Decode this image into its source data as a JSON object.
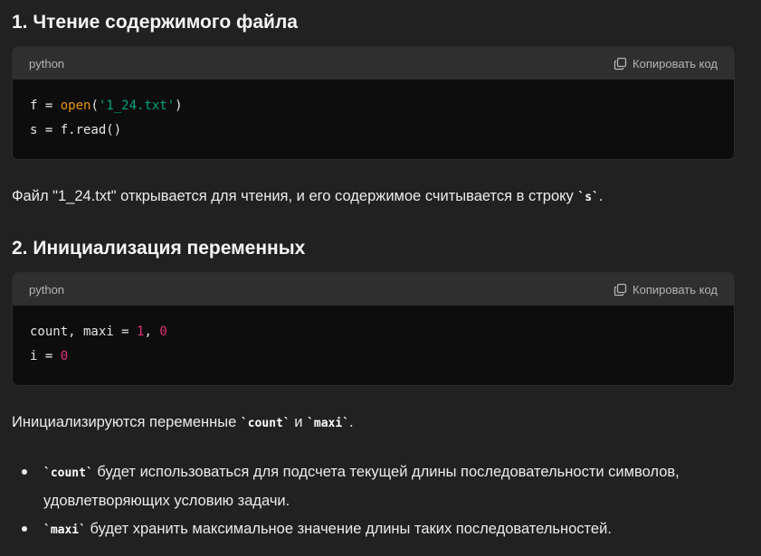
{
  "section1": {
    "heading": "1. Чтение содержимого файла",
    "code": {
      "language": "python",
      "copy_label": "Копировать код",
      "lines": [
        [
          {
            "t": "f = ",
            "c": "plain"
          },
          {
            "t": "open",
            "c": "fn"
          },
          {
            "t": "(",
            "c": "plain"
          },
          {
            "t": "'1_24.txt'",
            "c": "str"
          },
          {
            "t": ")",
            "c": "plain"
          }
        ],
        [
          {
            "t": "s = f.read()",
            "c": "plain"
          }
        ]
      ]
    },
    "paragraph": [
      {
        "t": "Файл \"1_24.txt\" открывается для чтения, и его содержимое считывается в строку ",
        "c": "text"
      },
      {
        "t": "`s`",
        "c": "code"
      },
      {
        "t": ".",
        "c": "text"
      }
    ]
  },
  "section2": {
    "heading": "2. Инициализация переменных",
    "code": {
      "language": "python",
      "copy_label": "Копировать код",
      "lines": [
        [
          {
            "t": "count, maxi = ",
            "c": "plain"
          },
          {
            "t": "1",
            "c": "num"
          },
          {
            "t": ", ",
            "c": "plain"
          },
          {
            "t": "0",
            "c": "num"
          }
        ],
        [
          {
            "t": "i = ",
            "c": "plain"
          },
          {
            "t": "0",
            "c": "num"
          }
        ]
      ]
    },
    "paragraph": [
      {
        "t": "Инициализируются переменные ",
        "c": "text"
      },
      {
        "t": "`count`",
        "c": "code"
      },
      {
        "t": " и ",
        "c": "text"
      },
      {
        "t": "`maxi`",
        "c": "code"
      },
      {
        "t": ".",
        "c": "text"
      }
    ],
    "bullets": [
      [
        {
          "t": "`count`",
          "c": "code"
        },
        {
          "t": " будет использоваться для подсчета текущей длины последовательности символов, удовлетворяющих условию задачи.",
          "c": "text"
        }
      ],
      [
        {
          "t": "`maxi`",
          "c": "code"
        },
        {
          "t": " будет хранить максимальное значение длины таких последовательностей.",
          "c": "text"
        }
      ]
    ]
  },
  "colors": {
    "background": "#212121",
    "code_header": "#2f2f2f",
    "code_body": "#0d0d0d",
    "function": "#e9950c",
    "string": "#00a67d",
    "number": "#df3079"
  },
  "icons": {
    "copy": "copy-icon"
  }
}
